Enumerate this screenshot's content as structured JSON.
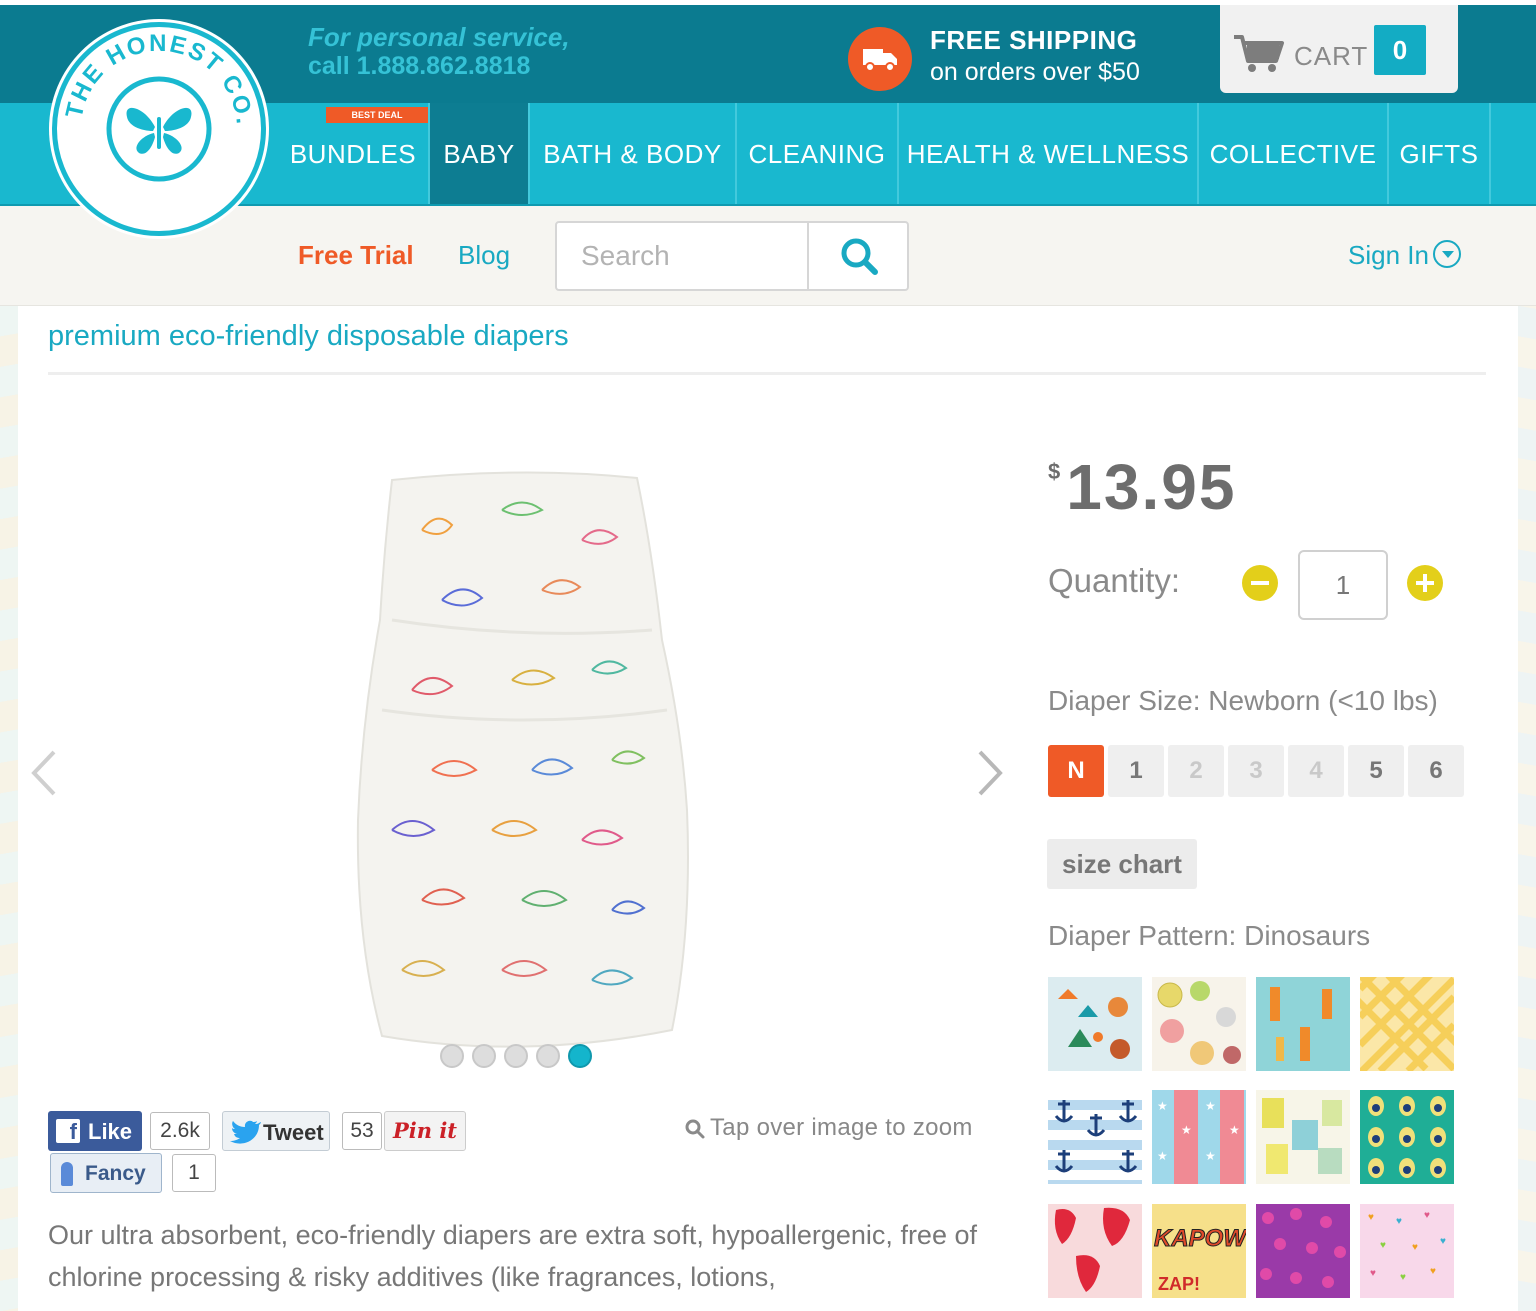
{
  "header": {
    "phone_line1": "For personal service,",
    "phone_line2": "call 1.888.862.8818",
    "shipping_title": "FREE SHIPPING",
    "shipping_sub": "on orders over $50",
    "cart_label": "CART",
    "cart_count": "0"
  },
  "logo": {
    "text": "THE HONEST CO."
  },
  "nav": {
    "badge": "BEST DEAL",
    "items": [
      {
        "label": "BUNDLES"
      },
      {
        "label": "BABY"
      },
      {
        "label": "BATH & BODY"
      },
      {
        "label": "CLEANING"
      },
      {
        "label": "HEALTH & WELLNESS"
      },
      {
        "label": "COLLECTIVE"
      },
      {
        "label": "GIFTS"
      }
    ],
    "active": "BABY"
  },
  "subnav": {
    "free_trial": "Free Trial",
    "blog": "Blog",
    "search_placeholder": "Search",
    "sign_in": "Sign In"
  },
  "product": {
    "tagline": "premium eco-friendly disposable diapers",
    "currency": "$",
    "price": "13.95",
    "quantity_label": "Quantity:",
    "quantity": "1",
    "size_label": "Diaper Size: Newborn (<10 lbs)",
    "sizes": [
      {
        "label": "N",
        "state": "selected"
      },
      {
        "label": "1",
        "state": "available"
      },
      {
        "label": "2",
        "state": "disabled"
      },
      {
        "label": "3",
        "state": "disabled"
      },
      {
        "label": "4",
        "state": "disabled"
      },
      {
        "label": "5",
        "state": "available"
      },
      {
        "label": "6",
        "state": "available"
      }
    ],
    "size_chart": "size chart",
    "pattern_label": "Diaper Pattern: Dinosaurs",
    "patterns": [
      "foxes",
      "fruit-slices",
      "giraffes",
      "yellow-gingham",
      "anchors",
      "stars-stripes",
      "letters",
      "peacock-feathers",
      "strawberries",
      "kapow-comic",
      "leopard-purple",
      "pink-hearts"
    ],
    "carousel_dots": 5,
    "carousel_active": 5,
    "zoom_hint": "Tap over image to zoom",
    "description": "Our ultra absorbent, eco-friendly diapers are extra soft, hypoallergenic, free of chlorine processing & risky additives (like fragrances, lotions,"
  },
  "social": {
    "like_label": "Like",
    "like_count": "2.6k",
    "tweet_label": "Tweet",
    "tweet_count": "53",
    "pin_label": "Pin it",
    "fancy_label": "Fancy",
    "fancy_count": "1"
  },
  "colors": {
    "header_dark": "#0b7b90",
    "nav": "#19b8cf",
    "accent_orange": "#ef5a27",
    "link_teal": "#19a9c2",
    "qty_yellow": "#e3cf1a"
  }
}
